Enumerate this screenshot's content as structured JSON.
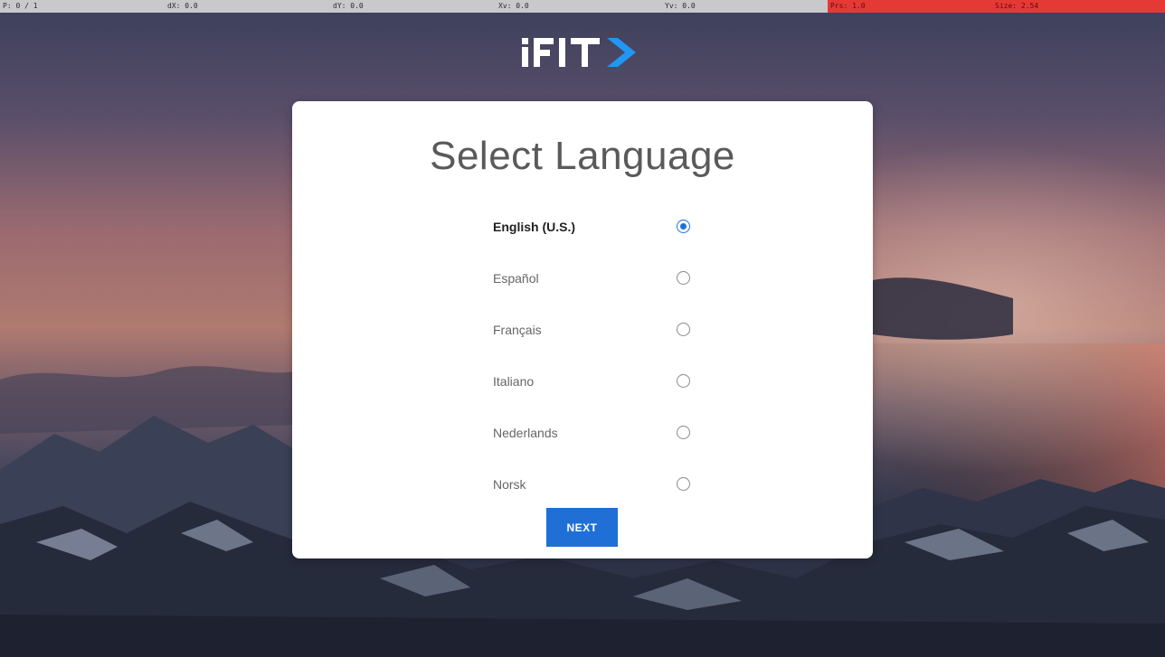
{
  "debug": {
    "p": "P: 0 / 1",
    "dx": "dX: 0.0",
    "dy": "dY: 0.0",
    "xv": "Xv: 0.0",
    "yv": "Yv: 0.0",
    "prs": "Prs: 1.0",
    "size": "Size: 2.54"
  },
  "logo": {
    "text": "iFIT",
    "accent_color": "#2196f3"
  },
  "card": {
    "title": "Select Language",
    "languages": [
      {
        "label": "English (U.S.)",
        "selected": true
      },
      {
        "label": "Español",
        "selected": false
      },
      {
        "label": "Français",
        "selected": false
      },
      {
        "label": "Italiano",
        "selected": false
      },
      {
        "label": "Nederlands",
        "selected": false
      },
      {
        "label": "Norsk",
        "selected": false
      }
    ],
    "next_label": "NEXT"
  },
  "colors": {
    "accent": "#1f6fd6",
    "debug_highlight": "#e53935"
  }
}
